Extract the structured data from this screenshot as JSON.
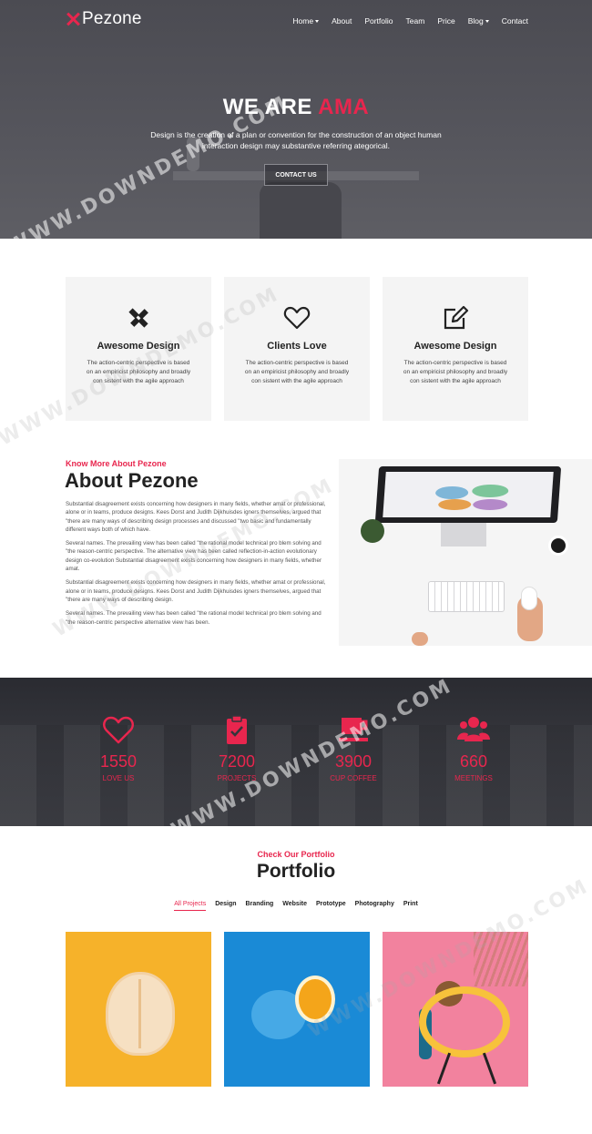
{
  "brand": {
    "name": "Pezone",
    "accent_color": "#e8264e"
  },
  "nav": {
    "items": [
      {
        "label": "Home",
        "dropdown": true
      },
      {
        "label": "About",
        "dropdown": false
      },
      {
        "label": "Portfolio",
        "dropdown": false
      },
      {
        "label": "Team",
        "dropdown": false
      },
      {
        "label": "Price",
        "dropdown": false
      },
      {
        "label": "Blog",
        "dropdown": true
      },
      {
        "label": "Contact",
        "dropdown": false
      }
    ]
  },
  "hero": {
    "title_prefix": "WE ARE",
    "title_accent": "AMA",
    "text": "Design is the creation of a plan or convention for the construction of an object human interaction design may substantive referring ategorical.",
    "button_label": "CONTACT US"
  },
  "features": [
    {
      "icon": "design-tools-icon",
      "title": "Awesome Design",
      "text": "The action-centric perspective is based on an empiricist philosophy and broadly con sistent with the agile approach"
    },
    {
      "icon": "heart-icon",
      "title": "Clients Love",
      "text": "The action-centric perspective is based on an empiricist philosophy and broadly con sistent with the agile approach"
    },
    {
      "icon": "edit-icon",
      "title": "Awesome Design",
      "text": "The action-centric perspective is based on an empiricist philosophy and broadly con sistent with the agile approach"
    }
  ],
  "about": {
    "subtitle": "Know More About Pezone",
    "title": "About Pezone",
    "paragraphs": [
      "Substantial disagreement exists concerning how designers in many fields, whether amat or professional, alone or in teams, produce designs. Kees Dorst and Judith Dijkhuisdes igners themselves, argued that \"there are many ways of describing design processes and discussed \"two basic and fundamentally different ways both of which have.",
      "Several names. The prevailing view has been called \"the rational model technical pro blem solving and \"the reason-centric perspective. The alternative view has been called reflection-in-action evolutionary design co-evolution Substantial disagreement exists concerning how designers in many fields, whether amat.",
      "Substantial disagreement exists concerning how designers in many fields, whether amat or professional, alone or in teams, produce designs. Kees Dorst and Judith Dijkhuisdes igners themselves, argued that \"there are many ways of describing design.",
      "Several names. The prevailing view has been called \"the rational model technical pro blem solving and \"the reason-centric perspective alternative view has been."
    ]
  },
  "stats": [
    {
      "icon": "heart-icon",
      "value": "1550",
      "label": "LOVE US"
    },
    {
      "icon": "clipboard-check-icon",
      "value": "7200",
      "label": "PROJECTS"
    },
    {
      "icon": "coffee-cup-icon",
      "value": "3900",
      "label": "CUP COFFEE"
    },
    {
      "icon": "users-icon",
      "value": "660",
      "label": "MEETINGS"
    }
  ],
  "portfolio": {
    "subtitle": "Check Our Portfolio",
    "title": "Portfolio",
    "filters": [
      "All Projects",
      "Design",
      "Branding",
      "Website",
      "Prototype",
      "Photography",
      "Print"
    ],
    "active_filter": "All Projects"
  },
  "watermark": "WWW.DOWNDEMO.COM"
}
